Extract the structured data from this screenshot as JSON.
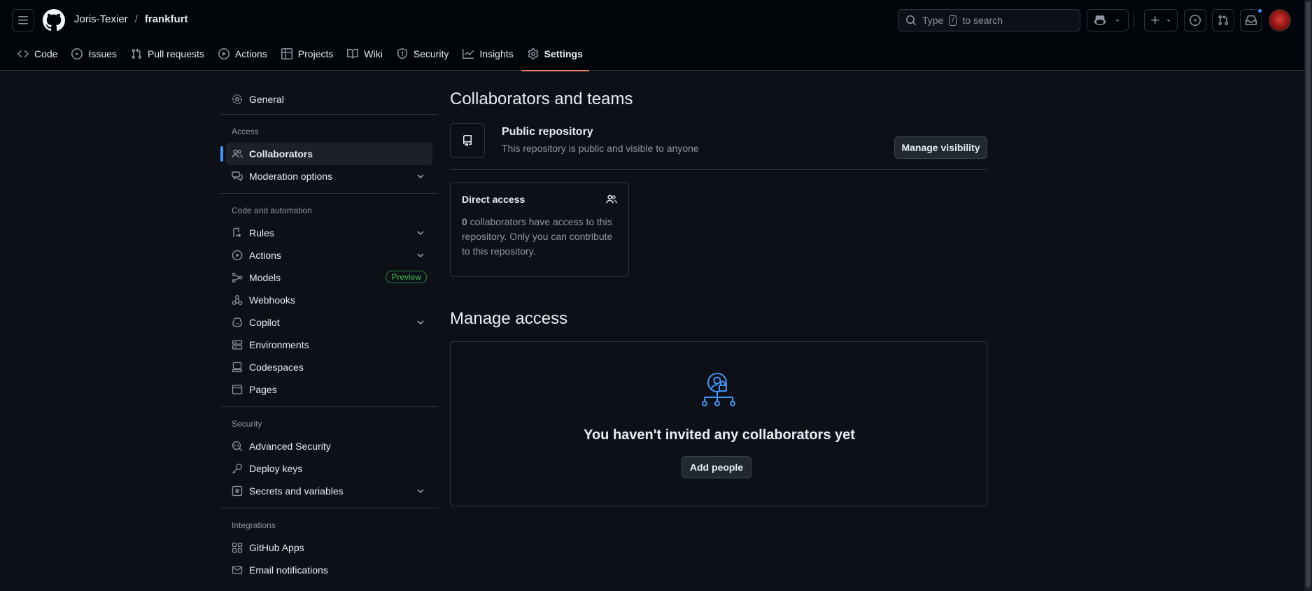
{
  "header": {
    "owner": "Joris-Texier",
    "separator": "/",
    "repo": "frankfurt",
    "search_prefix": "Type",
    "search_key": "/",
    "search_suffix": "to search"
  },
  "repo_nav": [
    {
      "label": "Code",
      "icon": "code-icon"
    },
    {
      "label": "Issues",
      "icon": "issue-opened-icon"
    },
    {
      "label": "Pull requests",
      "icon": "git-pull-request-icon"
    },
    {
      "label": "Actions",
      "icon": "play-icon"
    },
    {
      "label": "Projects",
      "icon": "table-icon"
    },
    {
      "label": "Wiki",
      "icon": "book-icon"
    },
    {
      "label": "Security",
      "icon": "shield-icon"
    },
    {
      "label": "Insights",
      "icon": "graph-icon"
    },
    {
      "label": "Settings",
      "icon": "gear-icon",
      "active": true
    }
  ],
  "sidebar": {
    "general": "General",
    "access_heading": "Access",
    "collaborators": "Collaborators",
    "moderation": "Moderation options",
    "code_heading": "Code and automation",
    "rules": "Rules",
    "actions": "Actions",
    "models": "Models",
    "models_badge": "Preview",
    "webhooks": "Webhooks",
    "copilot": "Copilot",
    "environments": "Environments",
    "codespaces": "Codespaces",
    "pages": "Pages",
    "security_heading": "Security",
    "advanced_security": "Advanced Security",
    "deploy_keys": "Deploy keys",
    "secrets": "Secrets and variables",
    "integrations_heading": "Integrations",
    "github_apps": "GitHub Apps",
    "email_notifications": "Email notifications"
  },
  "main": {
    "title": "Collaborators and teams",
    "public_title": "Public repository",
    "public_desc": "This repository is public and visible to anyone",
    "manage_visibility": "Manage visibility",
    "direct_access_title": "Direct access",
    "direct_count": "0",
    "direct_text": " collaborators have access to this repository. Only you can contribute to this repository.",
    "manage_title": "Manage access",
    "blank_text": "You haven't invited any collaborators yet",
    "add_people": "Add people"
  },
  "colors": {
    "accent": "#4493f8",
    "active_tab_underline": "#f78166",
    "preview_badge": "#3fb950"
  }
}
